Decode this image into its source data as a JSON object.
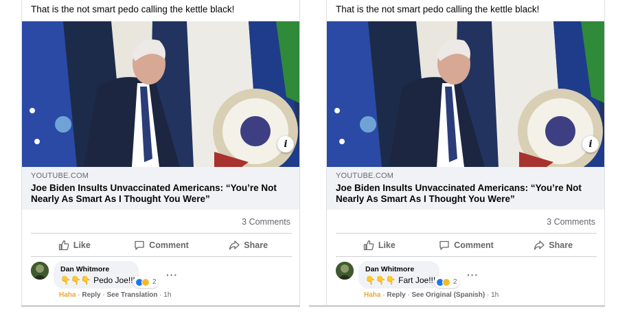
{
  "posts": [
    {
      "text": "That is the not smart pedo calling the kettle black!",
      "link": {
        "domain": "YOUTUBE.COM",
        "title": "Joe Biden Insults Unvaccinated Americans: “You’re Not Nearly As Smart As I Thought You Were”",
        "info_icon": "info-icon"
      },
      "comments_count": "3 Comments",
      "actions": {
        "like": "Like",
        "comment": "Comment",
        "share": "Share"
      },
      "comment": {
        "author": "Dan Whitmore",
        "emoji": "👇👇👇",
        "text": "Pedo Joe!!!",
        "reaction_count": "2",
        "more": "···",
        "meta": {
          "reaction": "Haha",
          "sep1": " · ",
          "reply": "Reply",
          "sep2": " · ",
          "link": "See Translation",
          "sep3": " · ",
          "time": "1h"
        }
      }
    },
    {
      "text": "That is the not smart pedo calling the kettle black!",
      "link": {
        "domain": "YOUTUBE.COM",
        "title": "Joe Biden Insults Unvaccinated Americans: “You’re Not Nearly As Smart As I Thought You Were”",
        "info_icon": "info-icon"
      },
      "comments_count": "3 Comments",
      "actions": {
        "like": "Like",
        "comment": "Comment",
        "share": "Share"
      },
      "comment": {
        "author": "Dan Whitmore",
        "emoji": "👇👇👇",
        "text": "Fart Joe!!!",
        "reaction_count": "2",
        "more": "···",
        "meta": {
          "reaction": "Haha",
          "sep1": " · ",
          "reply": "Reply",
          "sep2": " · ",
          "link": "See Original (Spanish)",
          "sep3": " · ",
          "time": "1h"
        }
      }
    }
  ],
  "colors": {
    "background": "#ffffff",
    "link_box": "#f0f2f5",
    "muted_text": "#65676b",
    "like_blue": "#1877f2",
    "haha_yellow": "#f7b928"
  }
}
